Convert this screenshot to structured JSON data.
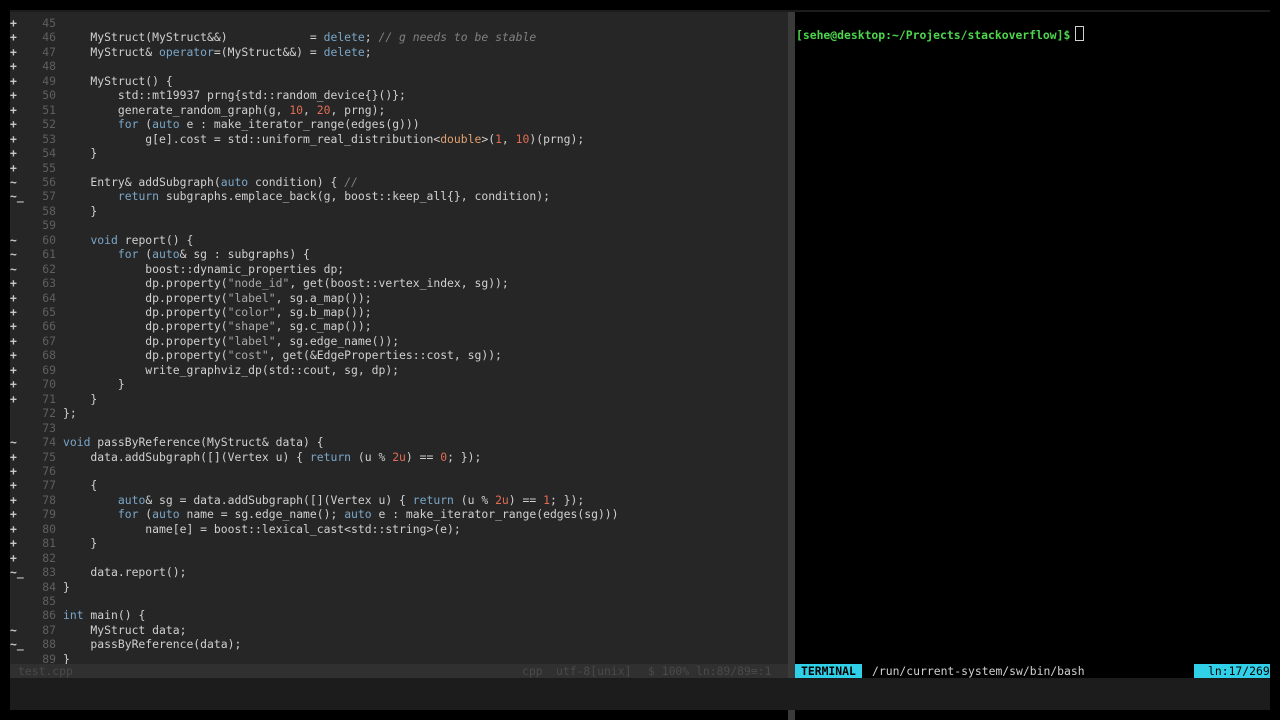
{
  "editor": {
    "lines": [
      {
        "n": "45",
        "s": "+",
        "t": ""
      },
      {
        "n": "46",
        "s": "+",
        "t": "    MyStruct(MyStruct&&)            = delete; // g needs to be stable"
      },
      {
        "n": "47",
        "s": "+",
        "t": "    MyStruct& operator=(MyStruct&&) = delete;"
      },
      {
        "n": "48",
        "s": "+",
        "t": ""
      },
      {
        "n": "49",
        "s": "+",
        "t": "    MyStruct() {"
      },
      {
        "n": "50",
        "s": "+",
        "t": "        std::mt19937 prng{std::random_device{}()};"
      },
      {
        "n": "51",
        "s": "+",
        "t": "        generate_random_graph(g, 10, 20, prng);"
      },
      {
        "n": "52",
        "s": "+",
        "t": "        for (auto e : make_iterator_range(edges(g)))"
      },
      {
        "n": "53",
        "s": "+",
        "t": "            g[e].cost = std::uniform_real_distribution<double>(1, 10)(prng);"
      },
      {
        "n": "54",
        "s": "+",
        "t": "    }"
      },
      {
        "n": "55",
        "s": "+",
        "t": ""
      },
      {
        "n": "56",
        "s": "~",
        "t": "    Entry& addSubgraph(auto condition) { //"
      },
      {
        "n": "57",
        "s": "~_",
        "t": "        return subgraphs.emplace_back(g, boost::keep_all{}, condition);"
      },
      {
        "n": "58",
        "s": "",
        "t": "    }"
      },
      {
        "n": "59",
        "s": "",
        "t": ""
      },
      {
        "n": "60",
        "s": "~",
        "t": "    void report() {"
      },
      {
        "n": "61",
        "s": "~",
        "t": "        for (auto& sg : subgraphs) {"
      },
      {
        "n": "62",
        "s": "~",
        "t": "            boost::dynamic_properties dp;"
      },
      {
        "n": "63",
        "s": "+",
        "t": "            dp.property(\"node_id\", get(boost::vertex_index, sg));"
      },
      {
        "n": "64",
        "s": "+",
        "t": "            dp.property(\"label\", sg.a_map());"
      },
      {
        "n": "65",
        "s": "+",
        "t": "            dp.property(\"color\", sg.b_map());"
      },
      {
        "n": "66",
        "s": "+",
        "t": "            dp.property(\"shape\", sg.c_map());"
      },
      {
        "n": "67",
        "s": "+",
        "t": "            dp.property(\"label\", sg.edge_name());"
      },
      {
        "n": "68",
        "s": "+",
        "t": "            dp.property(\"cost\", get(&EdgeProperties::cost, sg));"
      },
      {
        "n": "69",
        "s": "+",
        "t": "            write_graphviz_dp(std::cout, sg, dp);"
      },
      {
        "n": "70",
        "s": "+",
        "t": "        }"
      },
      {
        "n": "71",
        "s": "+",
        "t": "    }"
      },
      {
        "n": "72",
        "s": "",
        "t": "};"
      },
      {
        "n": "73",
        "s": "",
        "t": ""
      },
      {
        "n": "74",
        "s": "~",
        "t": "void passByReference(MyStruct& data) {"
      },
      {
        "n": "75",
        "s": "+",
        "t": "    data.addSubgraph([](Vertex u) { return (u % 2u) == 0; });"
      },
      {
        "n": "76",
        "s": "+",
        "t": ""
      },
      {
        "n": "77",
        "s": "+",
        "t": "    {"
      },
      {
        "n": "78",
        "s": "+",
        "t": "        auto& sg = data.addSubgraph([](Vertex u) { return (u % 2u) == 1; });"
      },
      {
        "n": "79",
        "s": "+",
        "t": "        for (auto name = sg.edge_name(); auto e : make_iterator_range(edges(sg)))"
      },
      {
        "n": "80",
        "s": "+",
        "t": "            name[e] = boost::lexical_cast<std::string>(e);"
      },
      {
        "n": "81",
        "s": "+",
        "t": "    }"
      },
      {
        "n": "82",
        "s": "+",
        "t": ""
      },
      {
        "n": "83",
        "s": "~_",
        "t": "    data.report();"
      },
      {
        "n": "84",
        "s": "",
        "t": "}"
      },
      {
        "n": "85",
        "s": "",
        "t": ""
      },
      {
        "n": "86",
        "s": "",
        "t": "int main() {"
      },
      {
        "n": "87",
        "s": "~",
        "t": "    MyStruct data;"
      },
      {
        "n": "88",
        "s": "~_",
        "t": "    passByReference(data);"
      },
      {
        "n": "89",
        "s": "",
        "t": "}"
      }
    ],
    "keywords": [
      "delete",
      "operator",
      "for",
      "auto",
      "return",
      "void",
      "int"
    ],
    "types": [
      "double"
    ],
    "status": {
      "filename": "test.cpp",
      "filetype": "cpp",
      "encoding": "utf-8[unix]",
      "position": "$ 100% ln:89/89≡:1"
    }
  },
  "terminal": {
    "prompt": "[sehe@desktop:~/Projects/stackoverflow]$",
    "badge": "TERMINAL",
    "path": "/run/current-system/sw/bin/bash",
    "position": "ln:17/269"
  }
}
